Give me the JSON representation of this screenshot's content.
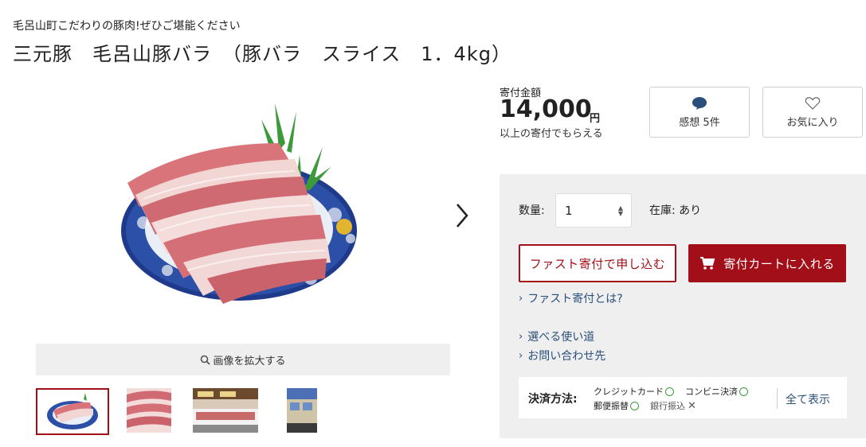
{
  "header": {
    "subtitle": "毛呂山町こだわりの豚肉!ぜひご堪能ください",
    "title": "三元豚　毛呂山豚バラ　（豚バラ　スライス　1．4kg）"
  },
  "gallery": {
    "zoom_label": "画像を拡大する",
    "thumbnails": [
      "pork-platter",
      "pork-slices",
      "meat-shop-counter",
      "shop-exterior"
    ]
  },
  "price": {
    "label": "寄付金額",
    "amount": "14,000",
    "unit": "円",
    "note": "以上の寄付でもらえる"
  },
  "actions": {
    "reviews_label": "感想 5件",
    "favorite_label": "お気に入り"
  },
  "purchase": {
    "quantity_label": "数量:",
    "quantity_value": "1",
    "stock_label": "在庫: あり",
    "fast_button": "ファスト寄付で申し込む",
    "cart_button": "寄付カートに入れる",
    "fast_help_link": "ファスト寄付とは?",
    "usage_link": "選べる使い道",
    "contact_link": "お問い合わせ先"
  },
  "payment": {
    "title": "決済方法:",
    "methods": [
      {
        "name": "クレジットカード",
        "status": "ok"
      },
      {
        "name": "コンビニ決済",
        "status": "ok"
      },
      {
        "name": "郵便振替",
        "status": "ok"
      },
      {
        "name": "銀行振込",
        "status": "ng"
      }
    ],
    "show_all": "全て表示"
  },
  "colors": {
    "accent": "#a30f18",
    "link": "#2a4f7a",
    "panel_bg": "#efefef"
  }
}
